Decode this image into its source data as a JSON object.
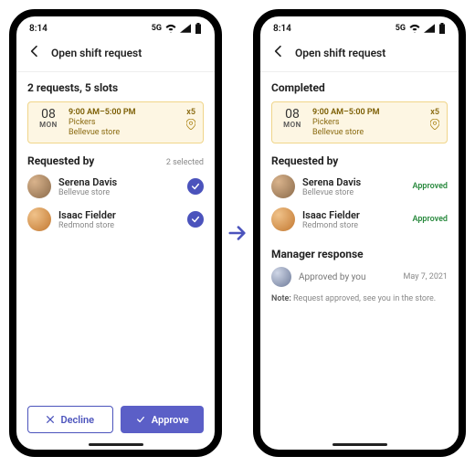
{
  "status": {
    "time": "8:14",
    "network": "5G"
  },
  "header": {
    "title": "Open shift request"
  },
  "left": {
    "summary": "2 requests, 5 slots",
    "selected_label": "2 selected",
    "requested_by_label": "Requested by",
    "buttons": {
      "decline": "Decline",
      "approve": "Approve"
    }
  },
  "right": {
    "summary": "Completed",
    "requested_by_label": "Requested by",
    "manager_label": "Manager response",
    "manager_status": "Approved by you",
    "manager_date": "May 7, 2021",
    "note_prefix": "Note:",
    "note_text": " Request approved, see you in the store."
  },
  "shift": {
    "day_num": "08",
    "day_dow": "MON",
    "time": "9:00 AM–5:00 PM",
    "role": "Pickers",
    "location": "Bellevue store",
    "slots": "x5"
  },
  "requesters": [
    {
      "name": "Serena Davis",
      "location": "Bellevue store",
      "status": "Approved"
    },
    {
      "name": "Isaac Fielder",
      "location": "Redmond store",
      "status": "Approved"
    }
  ]
}
